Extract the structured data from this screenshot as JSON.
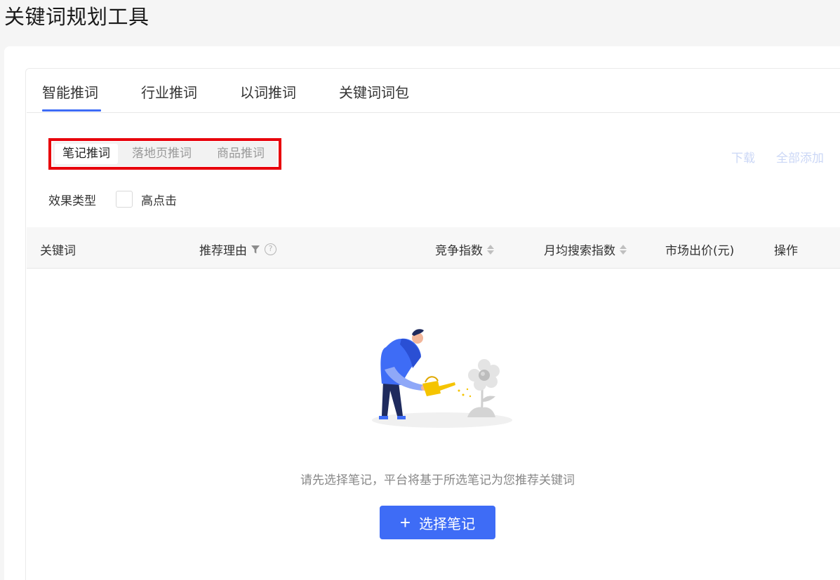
{
  "page": {
    "title": "关键词规划工具"
  },
  "main_tabs": [
    {
      "label": "智能推词",
      "active": true
    },
    {
      "label": "行业推词",
      "active": false
    },
    {
      "label": "以词推词",
      "active": false
    },
    {
      "label": "关键词词包",
      "active": false
    }
  ],
  "sub_tabs": [
    {
      "label": "笔记推词",
      "active": true
    },
    {
      "label": "落地页推词",
      "active": false
    },
    {
      "label": "商品推词",
      "active": false
    }
  ],
  "actions": {
    "download": "下载",
    "add_all": "全部添加"
  },
  "filter": {
    "label": "效果类型",
    "option": "高点击",
    "checked": false
  },
  "table": {
    "columns": [
      {
        "label": "关键词"
      },
      {
        "label": "推荐理由"
      },
      {
        "label": "竞争指数"
      },
      {
        "label": "月均搜索指数"
      },
      {
        "label": "市场出价(元)"
      },
      {
        "label": "操作"
      }
    ]
  },
  "empty_state": {
    "message": "请先选择笔记，平台将基于所选笔记为您推荐关键词",
    "button_label": "选择笔记"
  },
  "colors": {
    "accent": "#3e6cf6",
    "highlight_border": "#e8000b",
    "disabled_link": "#cbd7f6"
  }
}
